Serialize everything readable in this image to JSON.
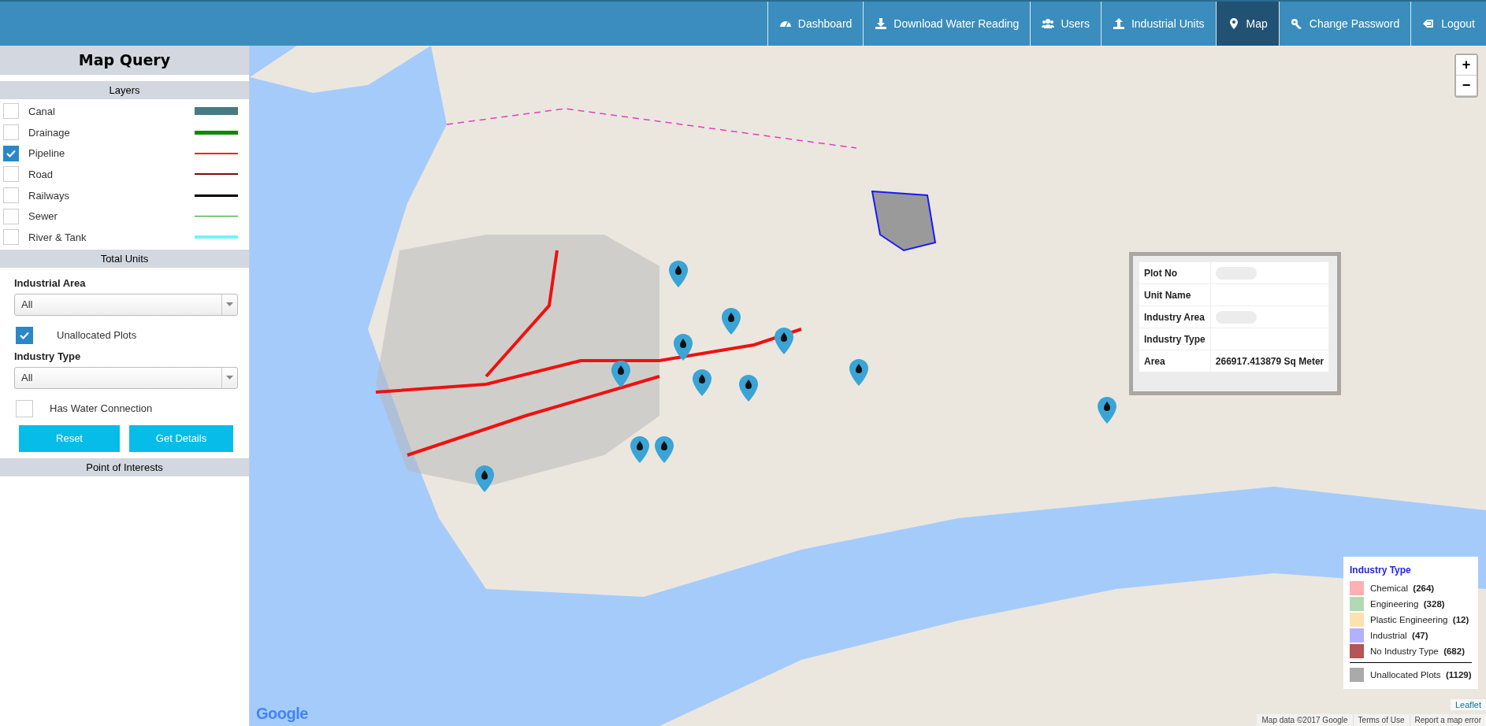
{
  "nav": {
    "items": [
      {
        "label": "Dashboard",
        "selected": false
      },
      {
        "label": "Download Water Reading",
        "selected": false
      },
      {
        "label": "Users",
        "selected": false
      },
      {
        "label": "Industrial Units",
        "selected": false
      },
      {
        "label": "Map",
        "selected": true
      },
      {
        "label": "Change Password",
        "selected": false
      },
      {
        "label": "Logout",
        "selected": false
      }
    ]
  },
  "sidebar": {
    "title": "Map Query",
    "layers": {
      "heading": "Layers",
      "items": [
        {
          "label": "Canal",
          "checked": false,
          "color": "#467b82"
        },
        {
          "label": "Drainage",
          "checked": false,
          "color": "#0a8a0a"
        },
        {
          "label": "Pipeline",
          "checked": true,
          "color": "#ff1a1a"
        },
        {
          "label": "Road",
          "checked": false,
          "color": "#7a0c0c"
        },
        {
          "label": "Railways",
          "checked": false,
          "color": "#000000"
        },
        {
          "label": "Sewer",
          "checked": false,
          "color": "#1f9a1f"
        },
        {
          "label": "River & Tank",
          "checked": false,
          "color": "#78f2f4"
        }
      ]
    },
    "total_units": {
      "heading": "Total Units",
      "industrial_area": {
        "label": "Industrial Area",
        "value": "All"
      },
      "unallocated_plots": {
        "label": "Unallocated Plots",
        "checked": true
      },
      "industry_type": {
        "label": "Industry Type",
        "value": "All"
      },
      "has_water_connection": {
        "label": "Has Water Connection",
        "checked": false
      },
      "buttons": [
        "Reset",
        "Get Details"
      ]
    },
    "point_of_interests": {
      "heading": "Point of Interests"
    }
  },
  "map": {
    "zoom_in": "+",
    "zoom_out": "−",
    "popup": {
      "rows": [
        {
          "label": "Plot No",
          "redacted": true
        },
        {
          "label": "Unit Name",
          "redacted": false
        },
        {
          "label": "Industry Area",
          "redacted": true
        },
        {
          "label": "Industry Type",
          "redacted": false
        },
        {
          "label": "Area",
          "value": "266917.413879 Sq Meter",
          "redacted": false
        }
      ]
    },
    "legend": {
      "title": "Industry Type",
      "items": [
        {
          "label": "Chemical",
          "count": "(264)",
          "color": "#ffb0b0"
        },
        {
          "label": "Engineering",
          "count": "(328)",
          "color": "#b2dab2"
        },
        {
          "label": "Plastic Engineering",
          "count": "(12)",
          "color": "#fde2b0"
        },
        {
          "label": "Industrial",
          "count": "(47)",
          "color": "#b2b2fc"
        },
        {
          "label": "No Industry Type",
          "count": "(682)",
          "color": "#b45556"
        }
      ],
      "total": {
        "label": "Unallocated Plots",
        "count": "(1129)",
        "color": "#aaaaaa"
      }
    },
    "google_logo": "Google",
    "leaflet": "Leaflet",
    "attribution": [
      "Map data ©2017 Google",
      "Terms of Use",
      "Report a map error"
    ]
  }
}
